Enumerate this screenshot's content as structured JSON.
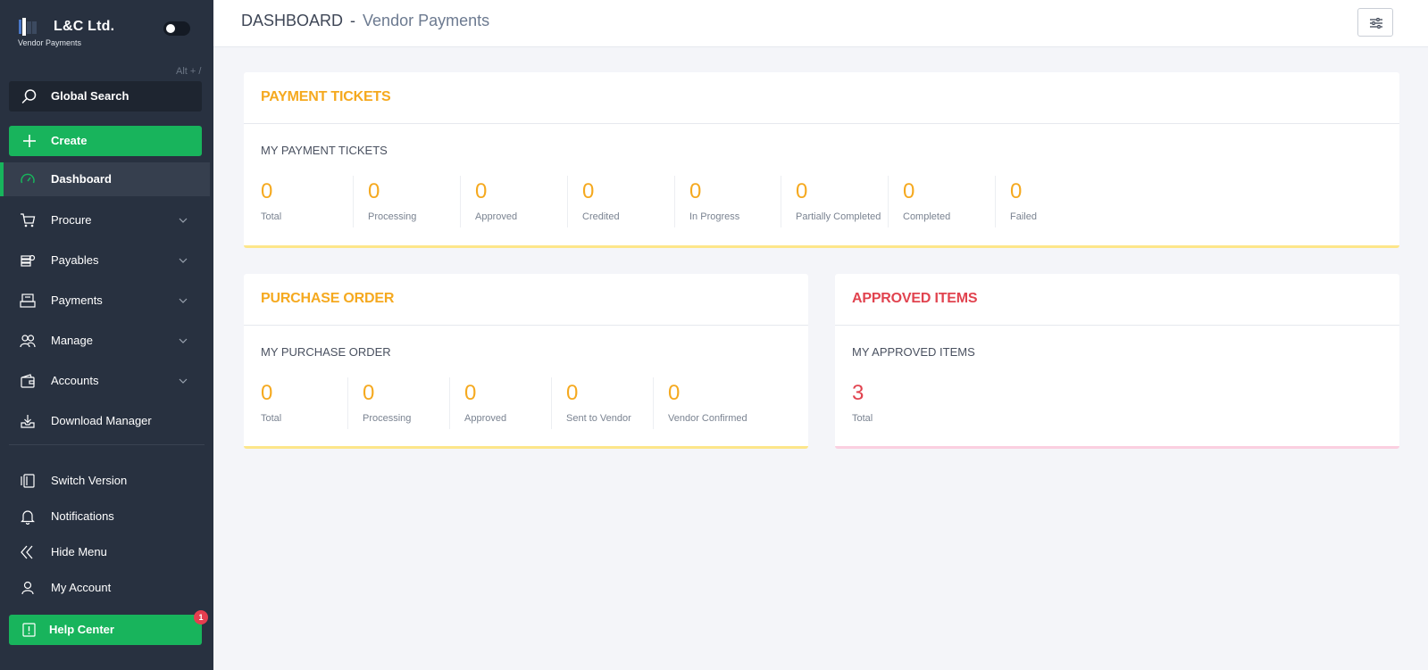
{
  "brand": {
    "name": "L&C Ltd.",
    "subtitle": "Vendor Payments"
  },
  "sidebar": {
    "shortcut_hint": "Alt + /",
    "search_label": "Global Search",
    "create_label": "Create",
    "nav": [
      {
        "label": "Dashboard",
        "icon": "speedometer-icon",
        "active": true
      },
      {
        "label": "Procure",
        "icon": "cart-icon"
      },
      {
        "label": "Payables",
        "icon": "coins-icon"
      },
      {
        "label": "Payments",
        "icon": "payment-terminal-icon"
      },
      {
        "label": "Manage",
        "icon": "users-icon"
      },
      {
        "label": "Accounts",
        "icon": "wallet-icon"
      },
      {
        "label": "Download Manager",
        "icon": "download-tray-icon"
      }
    ],
    "bottom": [
      {
        "label": "Switch Version",
        "icon": "switch-icon"
      },
      {
        "label": "Notifications",
        "icon": "bell-icon"
      },
      {
        "label": "Hide Menu",
        "icon": "double-chevron-left-icon"
      },
      {
        "label": "My Account",
        "icon": "user-icon"
      }
    ],
    "help_label": "Help Center",
    "help_badge": "1"
  },
  "header": {
    "title": "DASHBOARD",
    "separator": "-",
    "subtitle": "Vendor Payments"
  },
  "payment_tickets": {
    "title": "PAYMENT TICKETS",
    "subtitle": "MY PAYMENT TICKETS",
    "stats": [
      {
        "value": "0",
        "label": "Total"
      },
      {
        "value": "0",
        "label": "Processing"
      },
      {
        "value": "0",
        "label": "Approved"
      },
      {
        "value": "0",
        "label": "Credited"
      },
      {
        "value": "0",
        "label": "In Progress"
      },
      {
        "value": "0",
        "label": "Partially Completed"
      },
      {
        "value": "0",
        "label": "Completed"
      },
      {
        "value": "0",
        "label": "Failed"
      }
    ]
  },
  "purchase_order": {
    "title": "PURCHASE ORDER",
    "subtitle": "MY PURCHASE ORDER",
    "stats": [
      {
        "value": "0",
        "label": "Total"
      },
      {
        "value": "0",
        "label": "Processing"
      },
      {
        "value": "0",
        "label": "Approved"
      },
      {
        "value": "0",
        "label": "Sent to Vendor"
      },
      {
        "value": "0",
        "label": "Vendor Confirmed"
      }
    ]
  },
  "approved_items": {
    "title": "APPROVED ITEMS",
    "subtitle": "MY APPROVED ITEMS",
    "stats": [
      {
        "value": "3",
        "label": "Total"
      }
    ]
  },
  "colors": {
    "sidebar": "#283140",
    "accent_green": "#18b45c",
    "orange": "#f5a91f",
    "red": "#e1434f"
  }
}
